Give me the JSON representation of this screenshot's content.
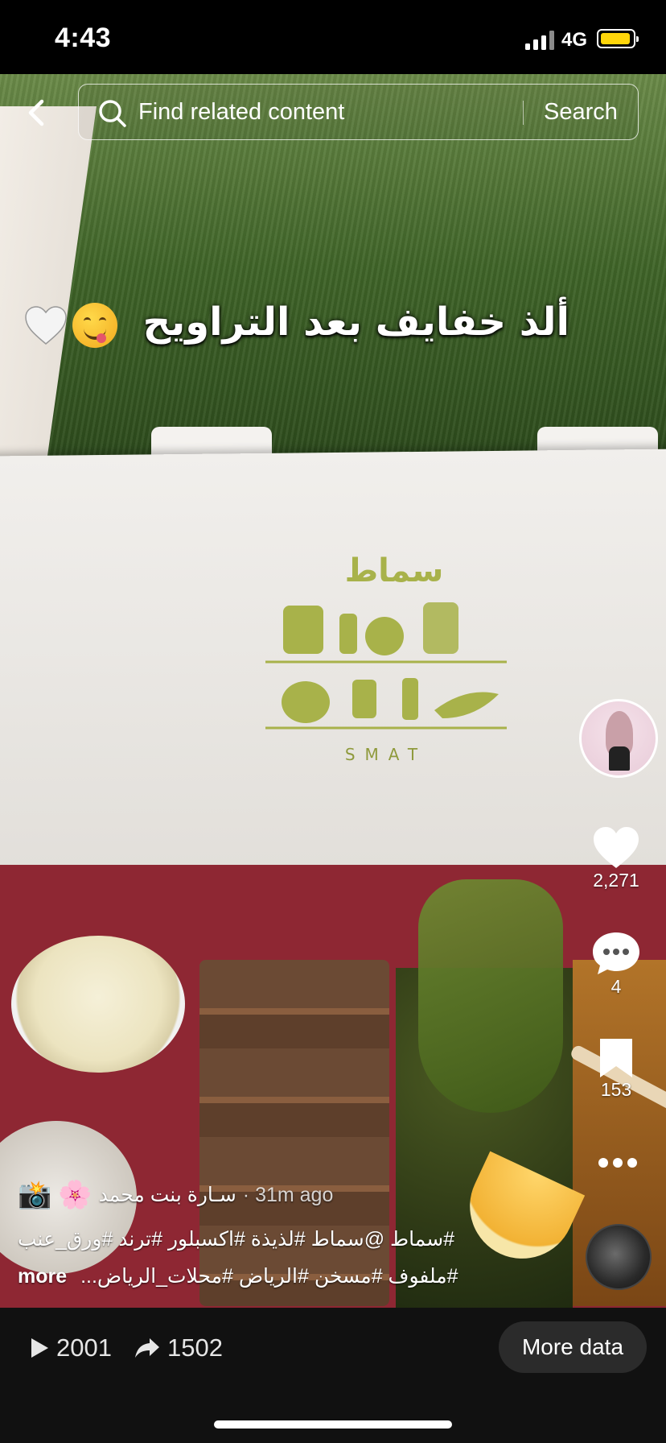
{
  "status_bar": {
    "time": "4:43",
    "network": "4G"
  },
  "search": {
    "placeholder": "Find related content",
    "button_label": "Search"
  },
  "video": {
    "overlay_text": "ألذ خفايف بعد التراويح",
    "brand_mark": "سماط",
    "brand_latin": "SMAT"
  },
  "actions": {
    "likes": "2,271",
    "comments": "4",
    "saves": "153"
  },
  "author": {
    "name": "سـارة بنت محمد",
    "time": "· 31m ago"
  },
  "caption": {
    "line1": "#سماط @سماط #لذيذة #اكسبلور #ترند #ورق_عنب",
    "line2": "#ملفوف #مسخن #الرياض #محلات_الرياض...",
    "more_label": "more"
  },
  "stats": {
    "plays": "2001",
    "shares": "1502",
    "more_data_label": "More data"
  },
  "colors": {
    "battery": "#ffd60a",
    "tray": "#8e2733"
  }
}
